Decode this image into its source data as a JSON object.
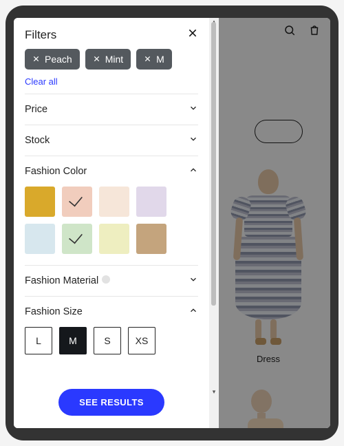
{
  "drawer": {
    "title": "Filters",
    "clear_all": "Clear all",
    "active_filters": [
      {
        "label": "Peach"
      },
      {
        "label": "Mint"
      },
      {
        "label": "M"
      }
    ],
    "sections": {
      "price": {
        "label": "Price",
        "expanded": false
      },
      "stock": {
        "label": "Stock",
        "expanded": false
      },
      "color": {
        "label": "Fashion Color",
        "expanded": true
      },
      "material": {
        "label": "Fashion Material",
        "expanded": false
      },
      "size": {
        "label": "Fashion Size",
        "expanded": true
      }
    },
    "colors": [
      {
        "name": "mustard",
        "hex": "#d9a92b",
        "selected": false
      },
      {
        "name": "peach",
        "hex": "#f1cdbd",
        "selected": true
      },
      {
        "name": "cream",
        "hex": "#f6e6d9",
        "selected": false
      },
      {
        "name": "lilac",
        "hex": "#e1d8ea",
        "selected": false
      },
      {
        "name": "paleblue",
        "hex": "#d7e7ee",
        "selected": false
      },
      {
        "name": "mint",
        "hex": "#cfe5c8",
        "selected": true
      },
      {
        "name": "butter",
        "hex": "#eeeec0",
        "selected": false
      },
      {
        "name": "tan",
        "hex": "#c4a47d",
        "selected": false
      }
    ],
    "sizes": [
      {
        "label": "L",
        "selected": false
      },
      {
        "label": "M",
        "selected": true
      },
      {
        "label": "S",
        "selected": false
      },
      {
        "label": "XS",
        "selected": false
      }
    ],
    "cta": "SEE RESULTS"
  },
  "store": {
    "product_label": "Dress"
  }
}
